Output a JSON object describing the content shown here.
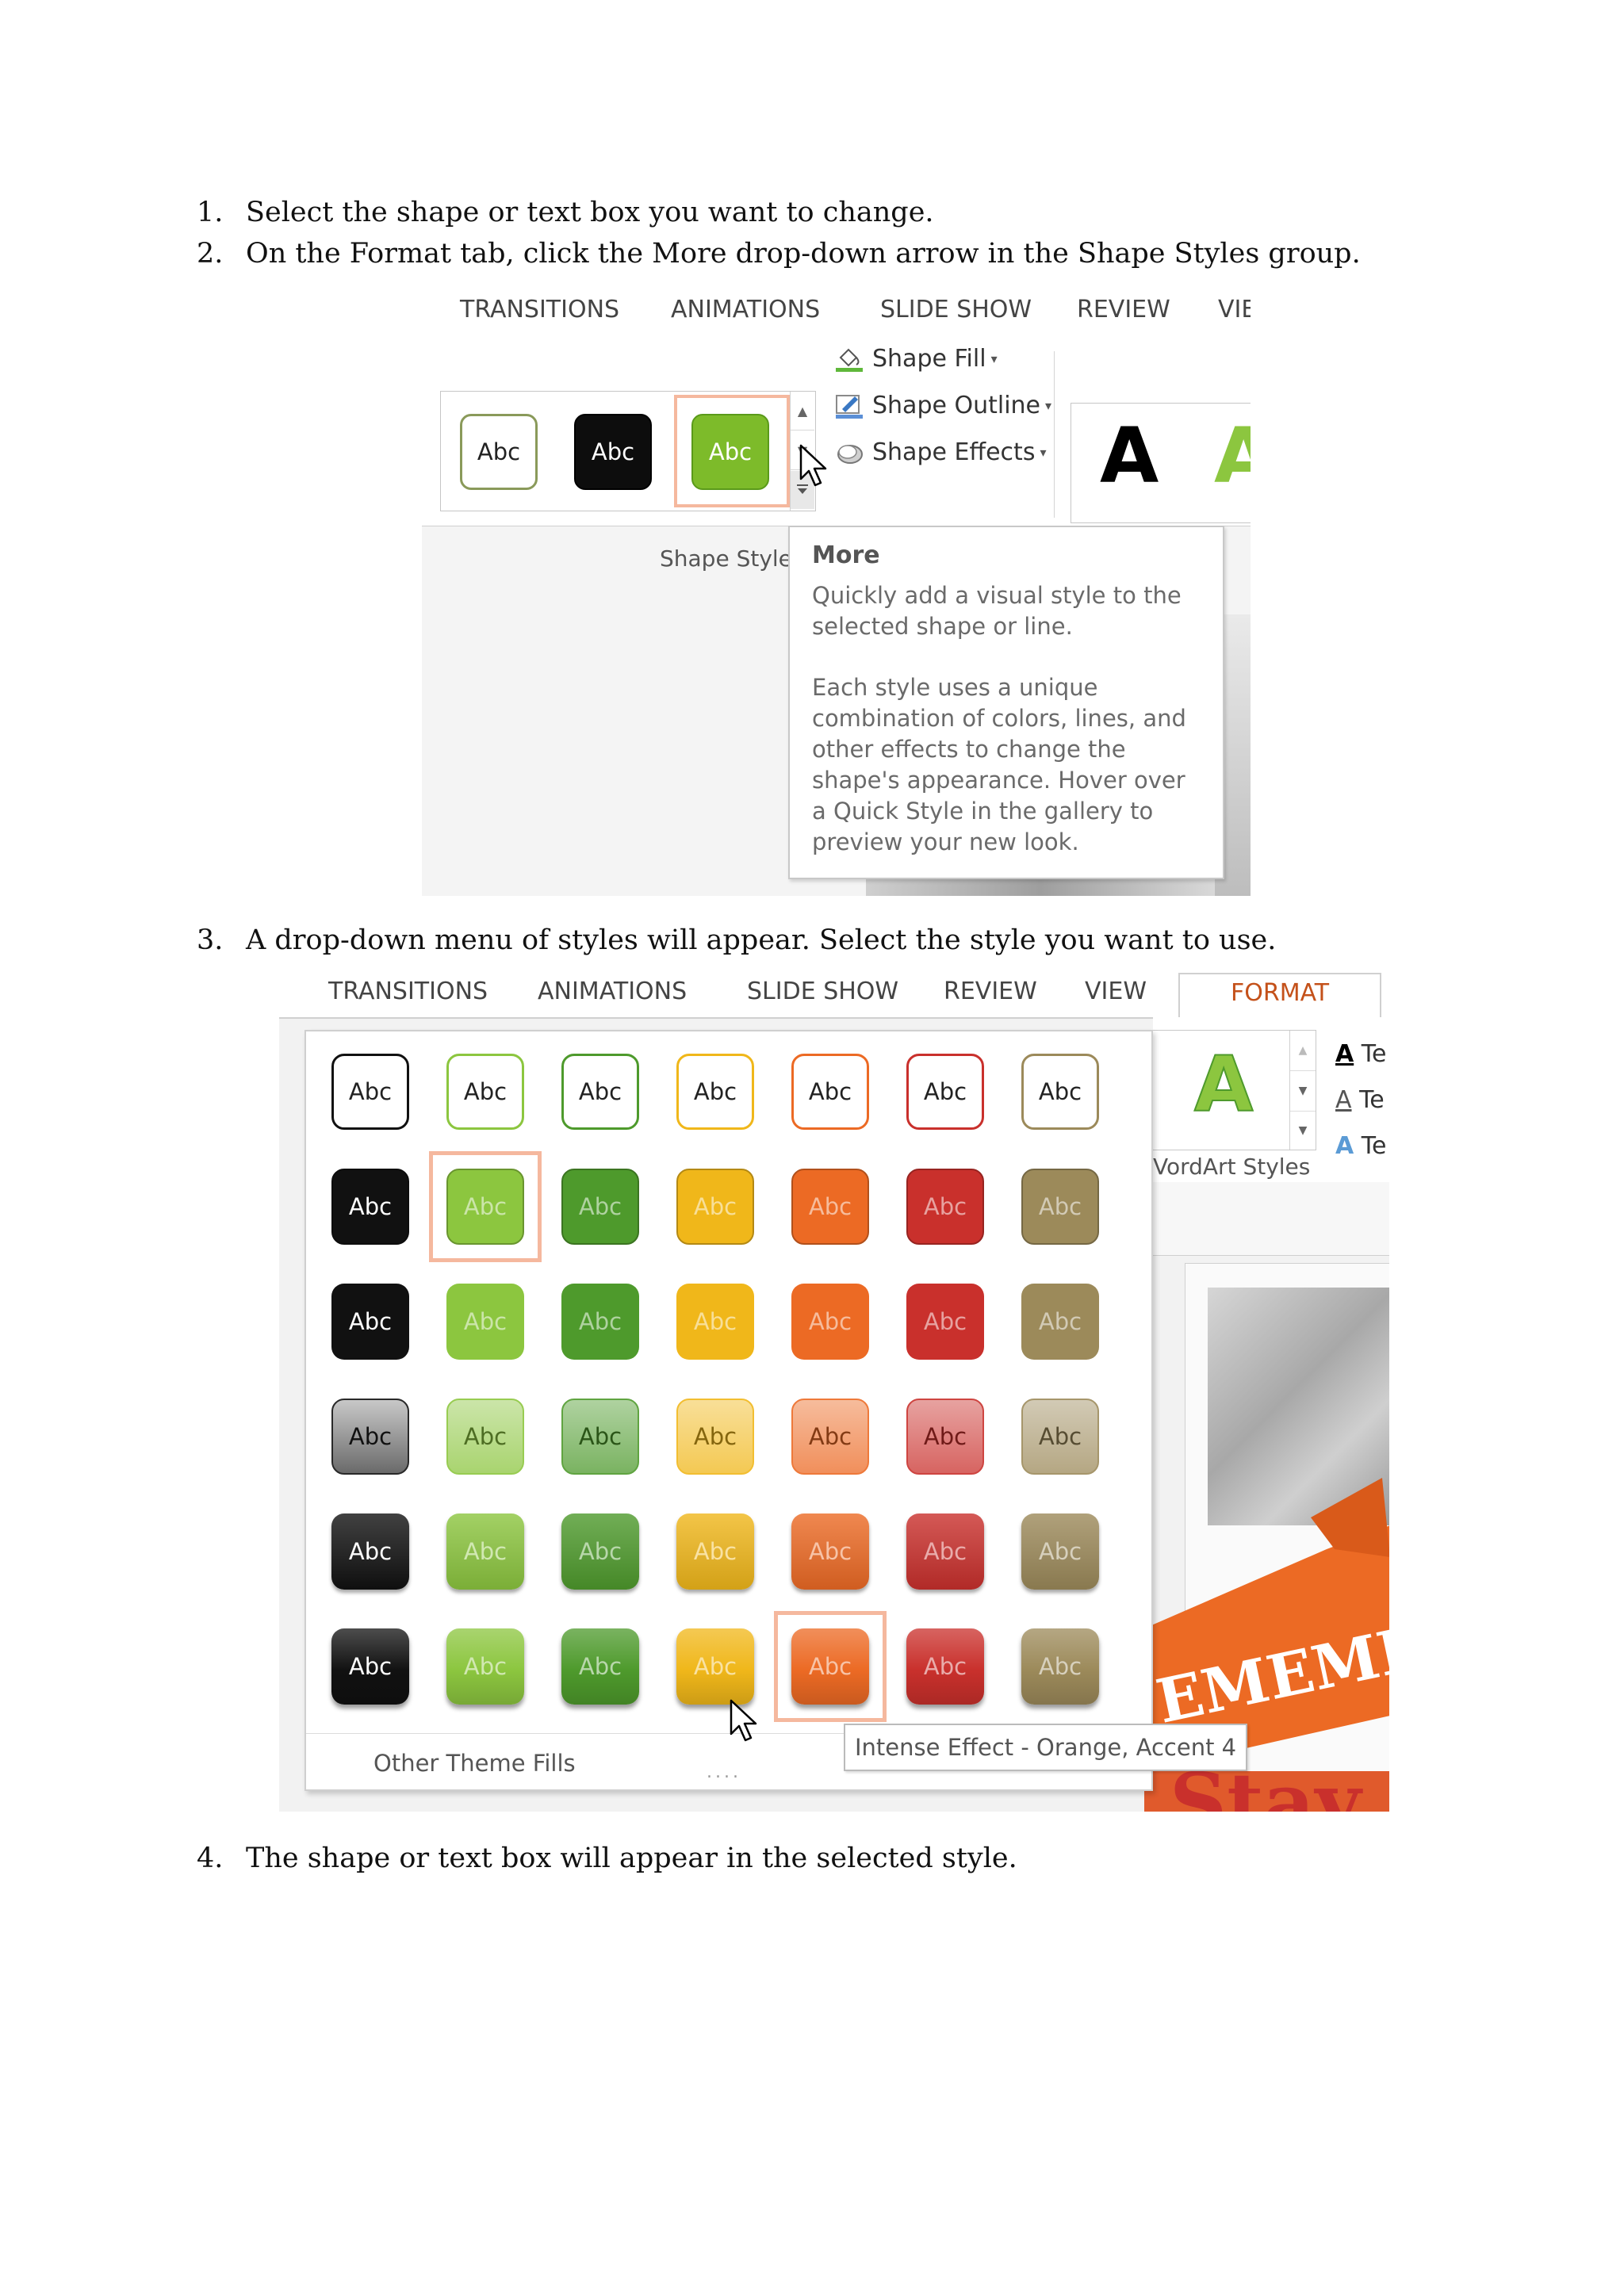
{
  "steps": [
    {
      "num": "1.",
      "text": "Select the shape or text box you want to change."
    },
    {
      "num": "2.",
      "text": "On the Format tab, click the More drop-down arrow in the Shape Styles group."
    },
    {
      "num": "3.",
      "text": "A drop-down menu of styles will appear. Select the style you want to use."
    },
    {
      "num": "4.",
      "text": "The shape or text box will appear in the selected style."
    }
  ],
  "screenshot1": {
    "tabs": [
      "TRANSITIONS",
      "ANIMATIONS",
      "SLIDE SHOW",
      "REVIEW",
      "VIE"
    ],
    "gallery_items": [
      {
        "label": "Abc",
        "style": "outline-olive"
      },
      {
        "label": "Abc",
        "style": "black-fill"
      },
      {
        "label": "Abc",
        "style": "green-fill-selected"
      }
    ],
    "commands": [
      {
        "label": "Shape Fill",
        "icon": "paint-bucket-icon"
      },
      {
        "label": "Shape Outline",
        "icon": "pencil-outline-icon"
      },
      {
        "label": "Shape Effects",
        "icon": "shape-effects-icon"
      }
    ],
    "group_label": "Shape Styles",
    "wordart_letters": [
      "A",
      "A"
    ],
    "tooltip": {
      "title": "More",
      "paragraph1": "Quickly add a visual style to the selected shape or line.",
      "paragraph2": "Each style uses a unique combination of colors, lines, and other effects to change the shape's appearance. Hover over a Quick Style in the gallery to preview your new look."
    }
  },
  "screenshot2": {
    "tabs": [
      "TRANSITIONS",
      "ANIMATIONS",
      "SLIDE SHOW",
      "REVIEW",
      "VIEW",
      "FORMAT"
    ],
    "active_tab": "FORMAT",
    "cell_label": "Abc",
    "colors": {
      "black": "#111111",
      "green": "#8cc63f",
      "darkgreen": "#4e9a2c",
      "gold": "#f0b71a",
      "orange": "#ec6a24",
      "red": "#c9302c",
      "olive": "#9c8a5a"
    },
    "footer_link": "Other Theme Fills",
    "footer_grip": "....",
    "wordart_group_label": "VordArt Styles",
    "wordart_letter": "A",
    "text_cmd_letters": [
      "Te",
      "Te",
      "Te"
    ],
    "banner_text": "EMEMBER",
    "slide_bottom_text": "Stay Ac",
    "tooltip": "Intense Effect - Orange, Accent 4"
  }
}
